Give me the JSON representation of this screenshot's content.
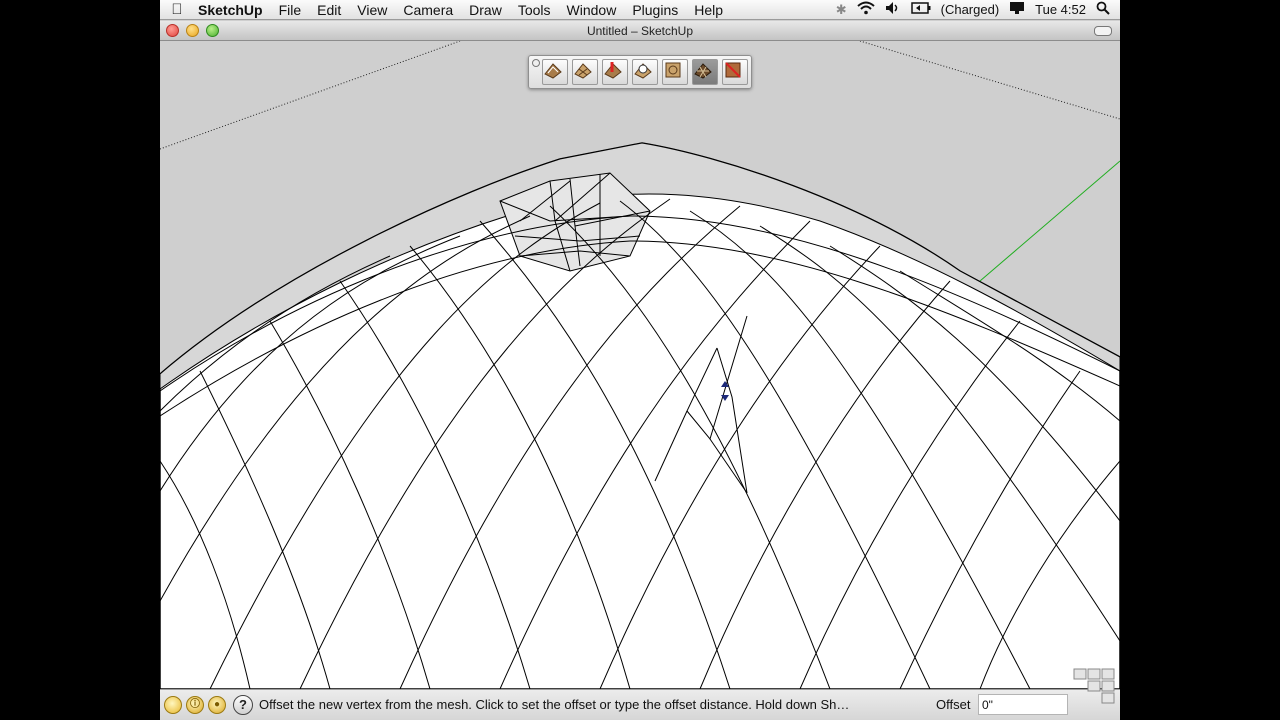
{
  "menubar": {
    "apple_icon": "apple-icon",
    "app_name": "SketchUp",
    "items": [
      "File",
      "Edit",
      "View",
      "Camera",
      "Draw",
      "Tools",
      "Window",
      "Plugins",
      "Help"
    ],
    "battery_status": "(Charged)",
    "clock": "Tue 4:52",
    "status_icons": [
      "bluetooth-icon",
      "wifi-icon",
      "volume-icon",
      "battery-icon",
      "display-icon",
      "spotlight-icon"
    ]
  },
  "window": {
    "title": "Untitled – SketchUp"
  },
  "toolbar": {
    "tools": [
      {
        "name": "from-contours-tool",
        "active": false
      },
      {
        "name": "from-scratch-tool",
        "active": false
      },
      {
        "name": "smoove-tool",
        "active": false
      },
      {
        "name": "stamp-tool",
        "active": false
      },
      {
        "name": "drape-tool",
        "active": false
      },
      {
        "name": "add-detail-tool",
        "active": true
      },
      {
        "name": "flip-edge-tool",
        "active": false
      }
    ]
  },
  "statusbar": {
    "message": "Offset the new vertex from the mesh.  Click to set the offset or type the offset distance.  Hold down Sh…",
    "vcb_label": "Offset",
    "vcb_value": "0\""
  },
  "colors": {
    "sky": "#cfcfcf",
    "surface": "#ffffff",
    "edge": "#000000",
    "green_axis": "#1fae1f",
    "cursor": "#1d2a7a"
  }
}
